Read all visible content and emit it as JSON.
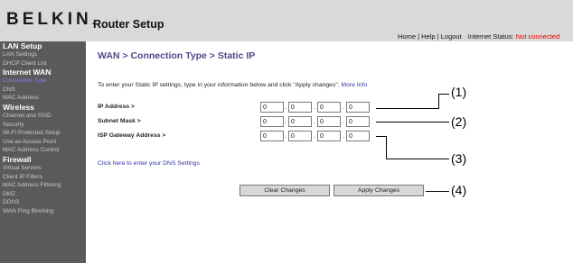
{
  "header": {
    "logo": "BELKIN",
    "logo_mark": ".",
    "title": "Router Setup",
    "links": {
      "home": "Home",
      "sep1": "|",
      "help": "Help",
      "sep2": "|",
      "logout": "Logout"
    },
    "status_label": "Internet Status:",
    "status_value": "Not connected",
    "status_color": "#e00000"
  },
  "sidebar": {
    "items": [
      {
        "label": "LAN Setup",
        "header": true
      },
      {
        "label": "LAN Settings"
      },
      {
        "label": "DHCP Client List"
      },
      {
        "label": "Internet WAN",
        "header": true
      },
      {
        "label": "Connection Type",
        "selected": true
      },
      {
        "label": "DNS"
      },
      {
        "label": "MAC Address"
      },
      {
        "label": "Wireless",
        "header": true
      },
      {
        "label": "Channel and SSID"
      },
      {
        "label": "Security"
      },
      {
        "label": "Wi-Fi Protected Setup"
      },
      {
        "label": "Use as Access Point"
      },
      {
        "label": "MAC Address Control"
      },
      {
        "label": "Firewall",
        "header": true
      },
      {
        "label": "Virtual Servers"
      },
      {
        "label": "Client IP Filters"
      },
      {
        "label": "MAC Address Filtering"
      },
      {
        "label": "DMZ"
      },
      {
        "label": "DDNS"
      },
      {
        "label": "WAN Ping Blocking"
      }
    ]
  },
  "main": {
    "title": "WAN > Connection Type > Static IP",
    "intro": "To enter your Static IP settings, type in your information below and click \"Apply changes\".",
    "more_info": "More Info",
    "fields": [
      {
        "label": "IP Address >",
        "octets": [
          "0",
          "0",
          "0",
          "0"
        ]
      },
      {
        "label": "Subnet Mask >",
        "octets": [
          "0",
          "0",
          "0",
          "0"
        ]
      },
      {
        "label": "ISP Gateway Address >",
        "octets": [
          "0",
          "0",
          "0",
          "0"
        ]
      }
    ],
    "dns_link": "Click here to enter your DNS Settings",
    "clear_button": "Clear Changes",
    "apply_button": "Apply Changes"
  },
  "callouts": [
    "(1)",
    "(2)",
    "(3)",
    "(4)"
  ]
}
